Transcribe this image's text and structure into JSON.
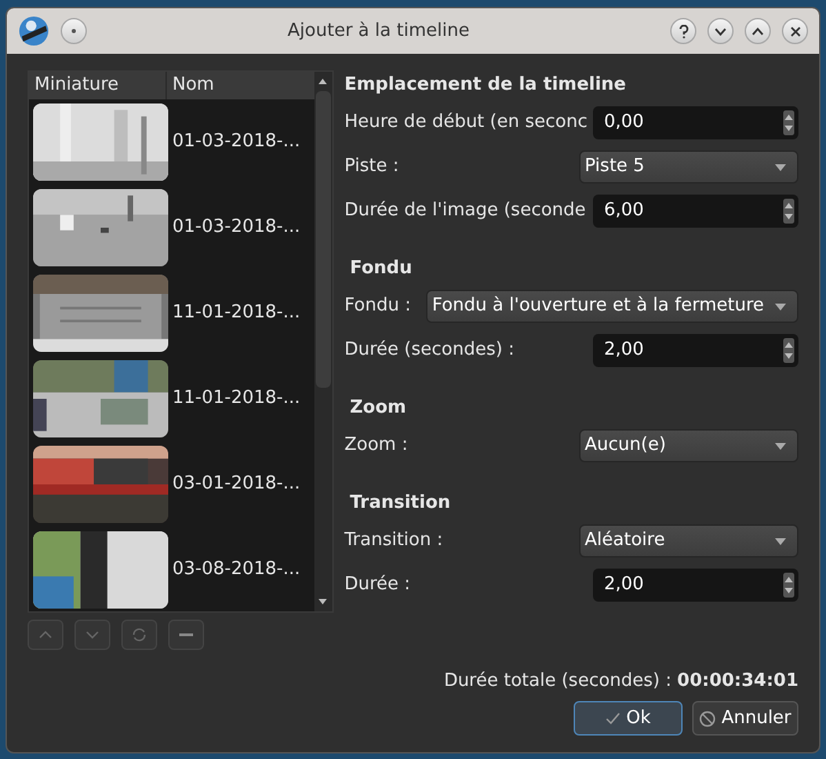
{
  "window": {
    "title": "Ajouter à la timeline"
  },
  "list": {
    "columns": [
      "Miniature",
      "Nom"
    ],
    "rows": [
      {
        "name": "01-03-2018-...",
        "kind": "picture"
      },
      {
        "name": "01-03-2018-...",
        "kind": "picture"
      },
      {
        "name": "11-01-2018-...",
        "kind": "picture"
      },
      {
        "name": "11-01-2018-...",
        "kind": "picture"
      },
      {
        "name": "03-01-2018-...",
        "kind": "picture"
      },
      {
        "name": "03-08-2018-...",
        "kind": "picture"
      }
    ]
  },
  "sections": [
    {
      "title": "Emplacement de la timeline",
      "fields": [
        {
          "kind": "spin",
          "label": "Heure de début (en seconc",
          "value": "0,00"
        },
        {
          "kind": "combo",
          "label": "Piste :",
          "value": "Piste 5"
        },
        {
          "kind": "spin",
          "label": "Durée de l'image (seconde",
          "value": "6,00"
        }
      ]
    },
    {
      "title": "Fondu",
      "fields": [
        {
          "kind": "combo",
          "label": "Fondu :",
          "value": "Fondu à l'ouverture et à la fermeture"
        },
        {
          "kind": "spin",
          "label": "Durée (secondes) :",
          "value": "2,00"
        }
      ]
    },
    {
      "title": "Zoom",
      "fields": [
        {
          "kind": "combo",
          "label": "Zoom :",
          "value": "Aucun(e)"
        }
      ]
    },
    {
      "title": "Transition",
      "fields": [
        {
          "kind": "combo",
          "label": "Transition :",
          "value": "Aléatoire"
        },
        {
          "kind": "spin",
          "label": "Durée :",
          "value": "2,00"
        }
      ]
    }
  ],
  "total": {
    "label": "Durée totale (secondes) :",
    "value": "00:00:34:01"
  },
  "buttons": [
    {
      "kind": "ok",
      "label": "Ok"
    },
    {
      "kind": "cancel",
      "label": "Annuler"
    }
  ]
}
